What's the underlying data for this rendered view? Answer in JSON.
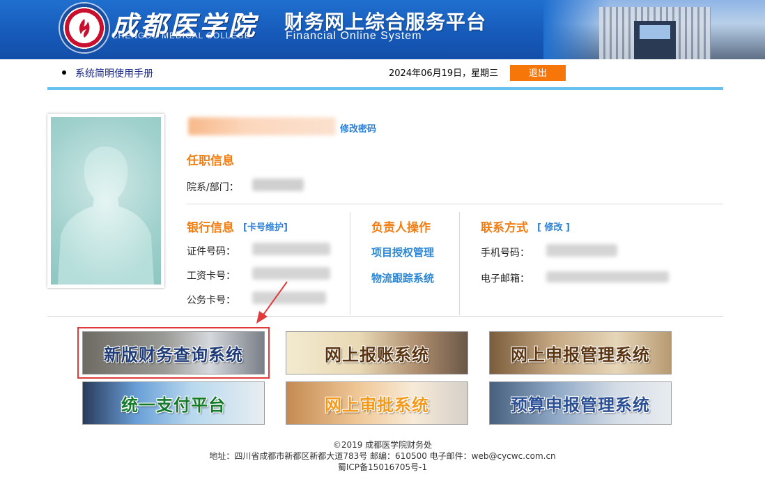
{
  "header": {
    "college_cn": "成都医学院",
    "college_en": "CHENGDU MEDICAL COLLEGE",
    "title_cn": "财务网上综合服务平台",
    "title_en": "Financial Online System"
  },
  "nav": {
    "manual_link": "系统简明使用手册",
    "date": "2024年06月19日，星期三",
    "logout": "退出"
  },
  "profile": {
    "change_password": "修改密码",
    "employment_title": "任职信息",
    "department_label": "院系/部门：",
    "bank_title": "银行信息",
    "card_maintain": "[卡号维护]",
    "id_label": "证件号码：",
    "salary_card_label": "工资卡号：",
    "official_card_label": "公务卡号：",
    "leader_title": "负责人操作",
    "project_auth": "项目授权管理",
    "logistics": "物流跟踪系统",
    "contact_title": "联系方式",
    "contact_edit": "[ 修改 ]",
    "mobile_label": "手机号码：",
    "email_label": "电子邮箱："
  },
  "systems": [
    {
      "label": "新版财务查询系统"
    },
    {
      "label": "网上报账系统"
    },
    {
      "label": "网上申报管理系统"
    },
    {
      "label": "统一支付平台"
    },
    {
      "label": "网上审批系统"
    },
    {
      "label": "预算申报管理系统"
    }
  ],
  "footer": {
    "copyright": "©2019 成都医学院财务处",
    "address": "地址：四川省成都市新都区新都大道783号 邮编：610500 电子邮件：web@cycwc.com.cn",
    "icp": "蜀ICP备15016705号-1"
  },
  "colors": {
    "header_blue": "#1659b8",
    "accent_orange": "#f07d12",
    "link_blue": "#2b7fd6",
    "divider_cyan": "#66c1ee",
    "logout_orange": "#f7760a",
    "highlight_red": "#e03a3a"
  }
}
